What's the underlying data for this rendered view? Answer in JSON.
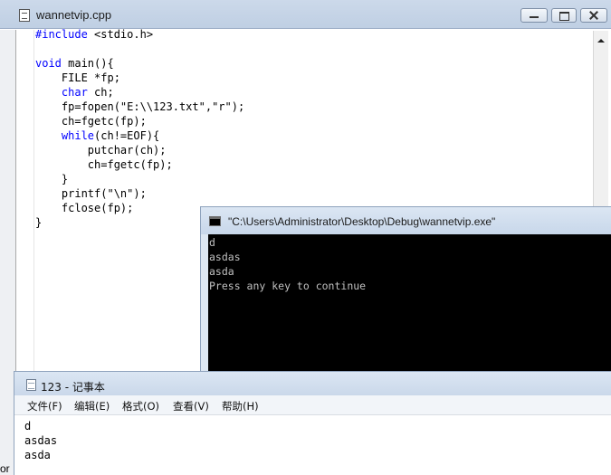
{
  "editor": {
    "title": "wannetvip.cpp",
    "code": {
      "l1_kw": "#include",
      "l1_rest": " <stdio.h>",
      "l2": "",
      "l3_kw": "void",
      "l3_rest": " main(){",
      "l4": "    FILE *fp;",
      "l5_indent": "    ",
      "l5_kw": "char",
      "l5_rest": " ch;",
      "l6": "    fp=fopen(\"E:\\\\123.txt\",\"r\");",
      "l7": "    ch=fgetc(fp);",
      "l8_indent": "    ",
      "l8_kw": "while",
      "l8_rest": "(ch!=EOF){",
      "l9": "        putchar(ch);",
      "l10": "        ch=fgetc(fp);",
      "l11": "    }",
      "l12": "    printf(\"\\n\");",
      "l13": "    fclose(fp);",
      "l14": "}"
    }
  },
  "console": {
    "title": "\"C:\\Users\\Administrator\\Desktop\\Debug\\wannetvip.exe\"",
    "lines": [
      "d",
      "asdas",
      "asda",
      "Press any key to continue"
    ]
  },
  "notepad": {
    "title": "123 - 记事本",
    "menu": {
      "file": "文件(F)",
      "edit": "编辑(E)",
      "format": "格式(O)",
      "view": "查看(V)",
      "help": "帮助(H)"
    },
    "lines": [
      "d",
      "asdas",
      "asda"
    ]
  },
  "bottom_edge_text": "or"
}
